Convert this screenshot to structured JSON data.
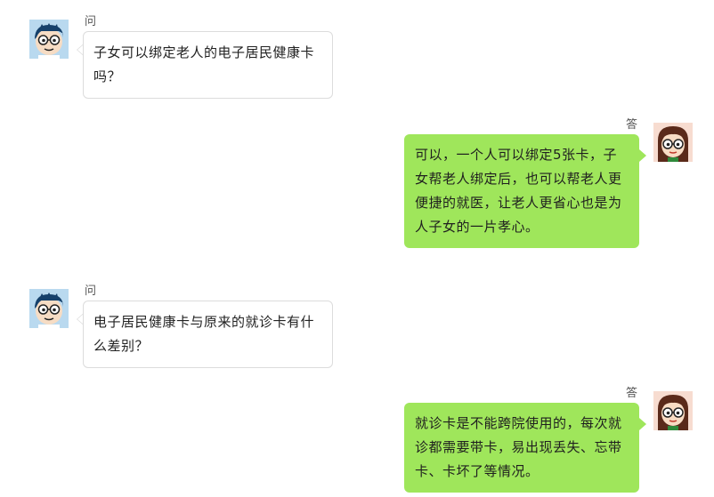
{
  "conversation": [
    {
      "role": "question",
      "label": "问",
      "text": "子女可以绑定老人的电子居民健康卡吗？"
    },
    {
      "role": "answer",
      "label": "答",
      "text": "可以，一个人可以绑定5张卡，子女帮老人绑定后，也可以帮老人更便捷的就医，让老人更省心也是为人子女的一片孝心。"
    },
    {
      "role": "question",
      "label": "问",
      "text": "电子居民健康卡与原来的就诊卡有什么差别？"
    },
    {
      "role": "answer",
      "label": "答",
      "text": "就诊卡是不能跨院使用的，每次就诊都需要带卡，易出现丢失、忘带卡、卡坏了等情况。"
    }
  ],
  "colors": {
    "answer_bubble": "#9fe65b",
    "question_border": "#dcdcdc",
    "question_bg": "#ffffff"
  },
  "icons": {
    "question_avatar": "boy-avatar-icon",
    "answer_avatar": "girl-avatar-icon"
  }
}
